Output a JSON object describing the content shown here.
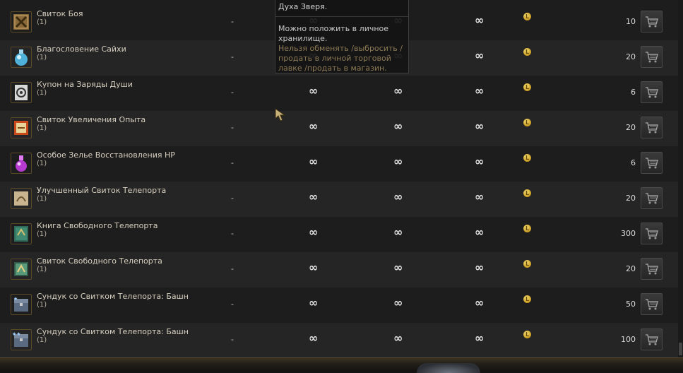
{
  "items": [
    {
      "name": "Свиток Боя",
      "count": "(1)",
      "col1": "-",
      "col2": "∞",
      "col3": "∞",
      "col4": "∞",
      "price": "10",
      "icon": "scroll-battle-icon"
    },
    {
      "name": "Благословение Сайхи",
      "count": "(1)",
      "col1": "-",
      "col2": "∞",
      "col3": "∞",
      "col4": "∞",
      "price": "20",
      "icon": "blue-potion-icon"
    },
    {
      "name": "Купон на Заряды Души",
      "count": "(1)",
      "col1": "-",
      "col2": "∞",
      "col3": "∞",
      "col4": "∞",
      "price": "6",
      "icon": "coupon-spiral-icon"
    },
    {
      "name": "Свиток Увеличения Опыта",
      "count": "(1)",
      "col1": "-",
      "col2": "∞",
      "col3": "∞",
      "col4": "∞",
      "price": "20",
      "icon": "exp-scroll-icon"
    },
    {
      "name": "Особое Зелье Восстановления HP",
      "count": "(1)",
      "col1": "-",
      "col2": "∞",
      "col3": "∞",
      "col4": "∞",
      "price": "6",
      "icon": "purple-potion-icon"
    },
    {
      "name": "Улучшенный Свиток Телепорта",
      "count": "(1)",
      "col1": "-",
      "col2": "∞",
      "col3": "∞",
      "col4": "∞",
      "price": "20",
      "icon": "teleport-scroll-icon"
    },
    {
      "name": "Книга Свободного Телепорта",
      "count": "(1)",
      "col1": "-",
      "col2": "∞",
      "col3": "∞",
      "col4": "∞",
      "price": "300",
      "icon": "teleport-book-icon"
    },
    {
      "name": "Свиток Свободного Телепорта",
      "count": "(1)",
      "col1": "-",
      "col2": "∞",
      "col3": "∞",
      "col4": "∞",
      "price": "20",
      "icon": "free-teleport-scroll-icon"
    },
    {
      "name": "Сундук со Свитком Телепорта: Башня Де",
      "count": "(1)",
      "col1": "-",
      "col2": "∞",
      "col3": "∞",
      "col4": "∞",
      "price": "50",
      "icon": "chest-one-star-icon"
    },
    {
      "name": "Сундук со Свитком Телепорта: Башня Де",
      "count": "(1)",
      "col1": "-",
      "col2": "∞",
      "col3": "∞",
      "col4": "∞",
      "price": "100",
      "icon": "chest-two-star-icon"
    }
  ],
  "coin_label": "L",
  "tooltip": {
    "title": "Духа Зверя.",
    "line1": "Можно положить в личное хранилище.",
    "line2": "Нельзя обменять /выбросить /продать в личной торговой лавке /продать в магазин."
  },
  "colors": {
    "accent": "#c99a1e",
    "row_odd": "#1d1d1d",
    "row_even": "#252525",
    "tooltip_warn": "#8c7a56"
  }
}
